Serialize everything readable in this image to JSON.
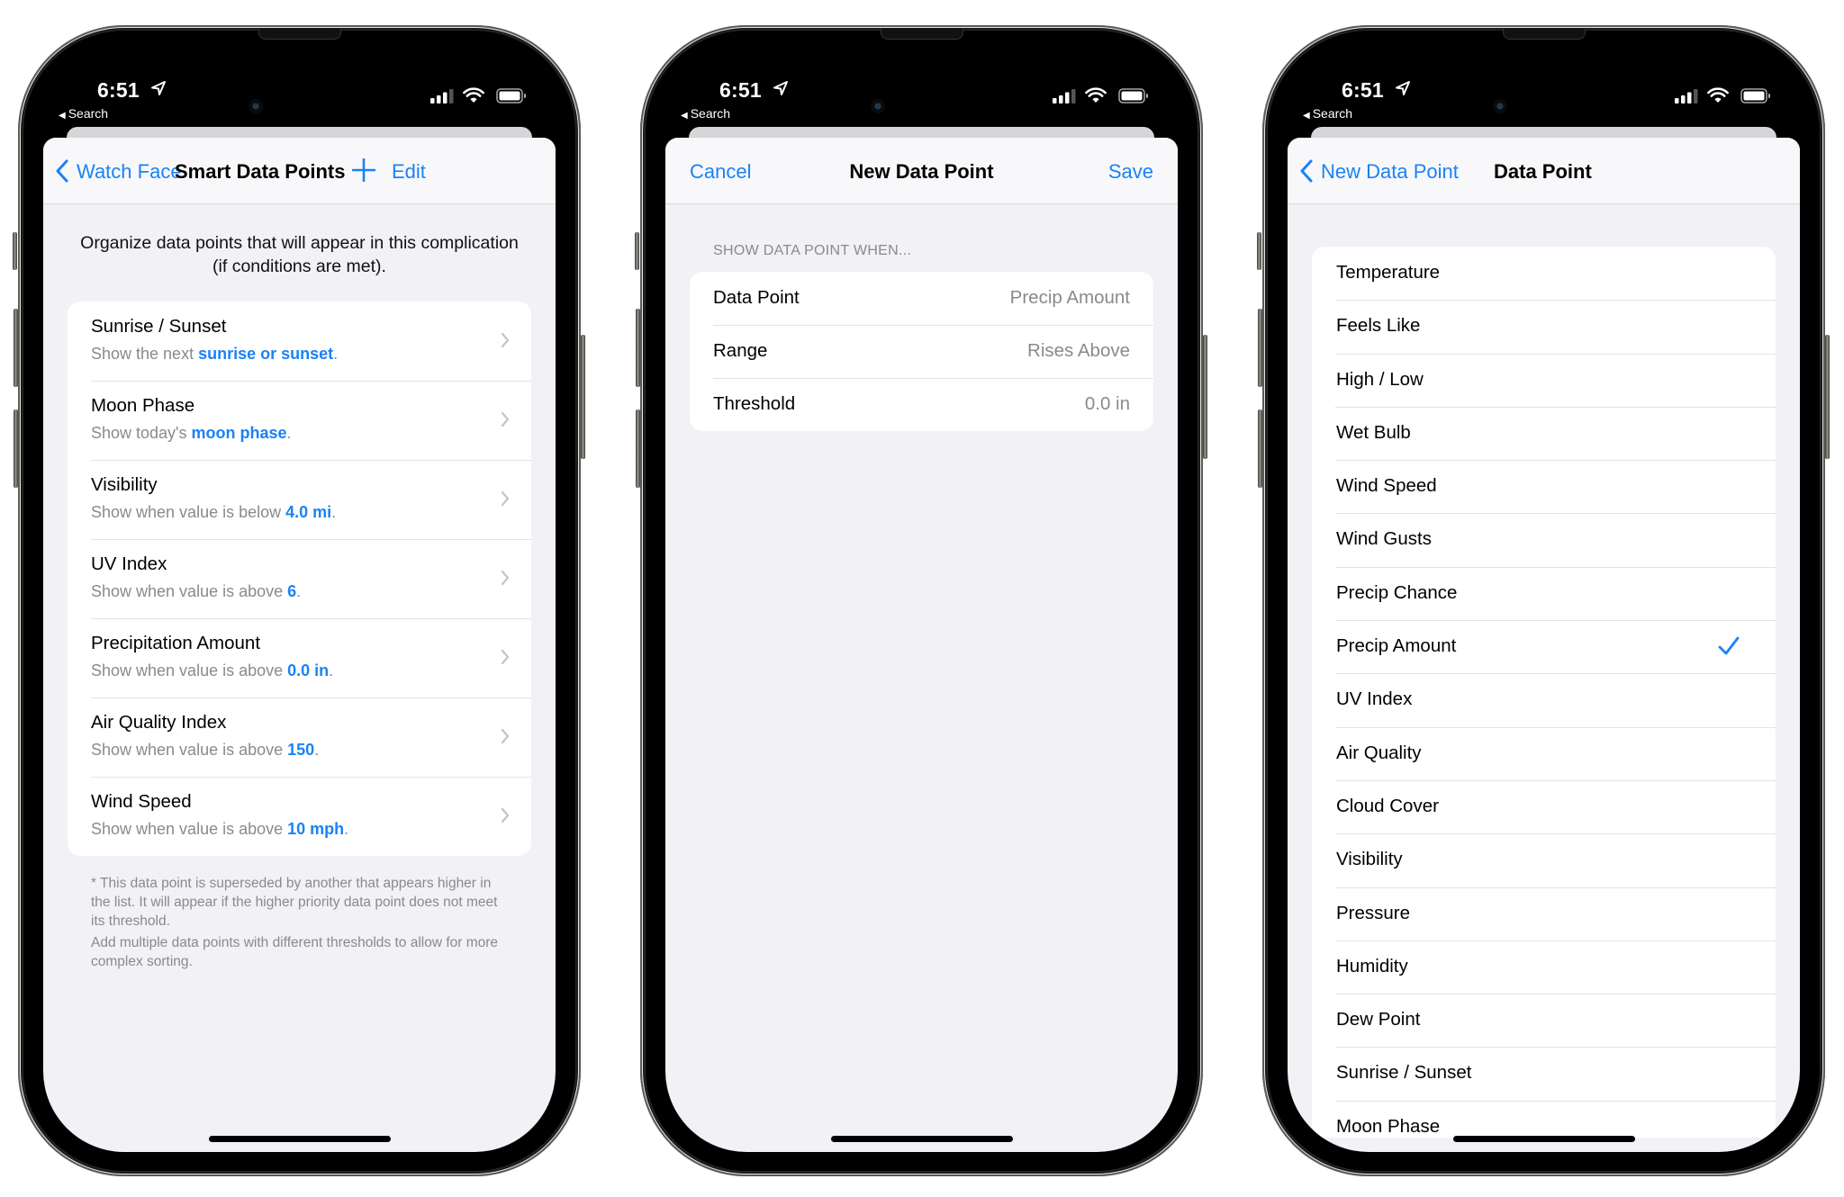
{
  "colors": {
    "accent": "#1a82f7",
    "secondary_text": "#8a8a8e",
    "grouped_background": "#f1f1f6",
    "card_background": "#ffffff"
  },
  "status_bar": {
    "time": "6:51",
    "back_app": "Search",
    "icons": [
      "location-arrow-icon",
      "cellular-signal-icon",
      "wifi-icon",
      "battery-icon"
    ]
  },
  "screens": [
    {
      "id": "smart-data-points",
      "nav": {
        "back_label": "Watch Face",
        "title": "Smart Data Points",
        "add_icon": "plus-icon",
        "edit_label": "Edit"
      },
      "intro": "Organize data points that will appear in this complication (if conditions are met).",
      "items": [
        {
          "title": "Sunrise / Sunset",
          "prefix": "Show the next ",
          "highlight": "sunrise or sunset",
          "suffix": "."
        },
        {
          "title": "Moon Phase",
          "prefix": "Show today's ",
          "highlight": "moon phase",
          "suffix": "."
        },
        {
          "title": "Visibility",
          "prefix": "Show when value is below ",
          "highlight": "4.0 mi",
          "suffix": "."
        },
        {
          "title": "UV Index",
          "prefix": "Show when value is above ",
          "highlight": "6",
          "suffix": "."
        },
        {
          "title": "Precipitation Amount",
          "prefix": "Show when value is above ",
          "highlight": "0.0 in",
          "suffix": "."
        },
        {
          "title": "Air Quality Index",
          "prefix": "Show when value is above ",
          "highlight": "150",
          "suffix": "."
        },
        {
          "title": "Wind Speed",
          "prefix": "Show when value is above ",
          "highlight": "10 mph",
          "suffix": "."
        }
      ],
      "footnotes": [
        "* This data point is superseded by another that appears higher in the list. It will appear if the higher priority data point does not meet its threshold.",
        "Add multiple data points with different thresholds to allow for more complex sorting."
      ]
    },
    {
      "id": "new-data-point",
      "nav": {
        "cancel_label": "Cancel",
        "title": "New Data Point",
        "save_label": "Save"
      },
      "section_header": "SHOW DATA POINT WHEN...",
      "fields": [
        {
          "label": "Data Point",
          "value": "Precip Amount"
        },
        {
          "label": "Range",
          "value": "Rises Above"
        },
        {
          "label": "Threshold",
          "value": "0.0 in"
        }
      ]
    },
    {
      "id": "data-point-picker",
      "nav": {
        "back_label": "New Data Point",
        "title": "Data Point"
      },
      "selected": "Precip Amount",
      "options": [
        "Temperature",
        "Feels Like",
        "High / Low",
        "Wet Bulb",
        "Wind Speed",
        "Wind Gusts",
        "Precip Chance",
        "Precip Amount",
        "UV Index",
        "Air Quality",
        "Cloud Cover",
        "Visibility",
        "Pressure",
        "Humidity",
        "Dew Point",
        "Sunrise / Sunset",
        "Moon Phase"
      ]
    }
  ]
}
